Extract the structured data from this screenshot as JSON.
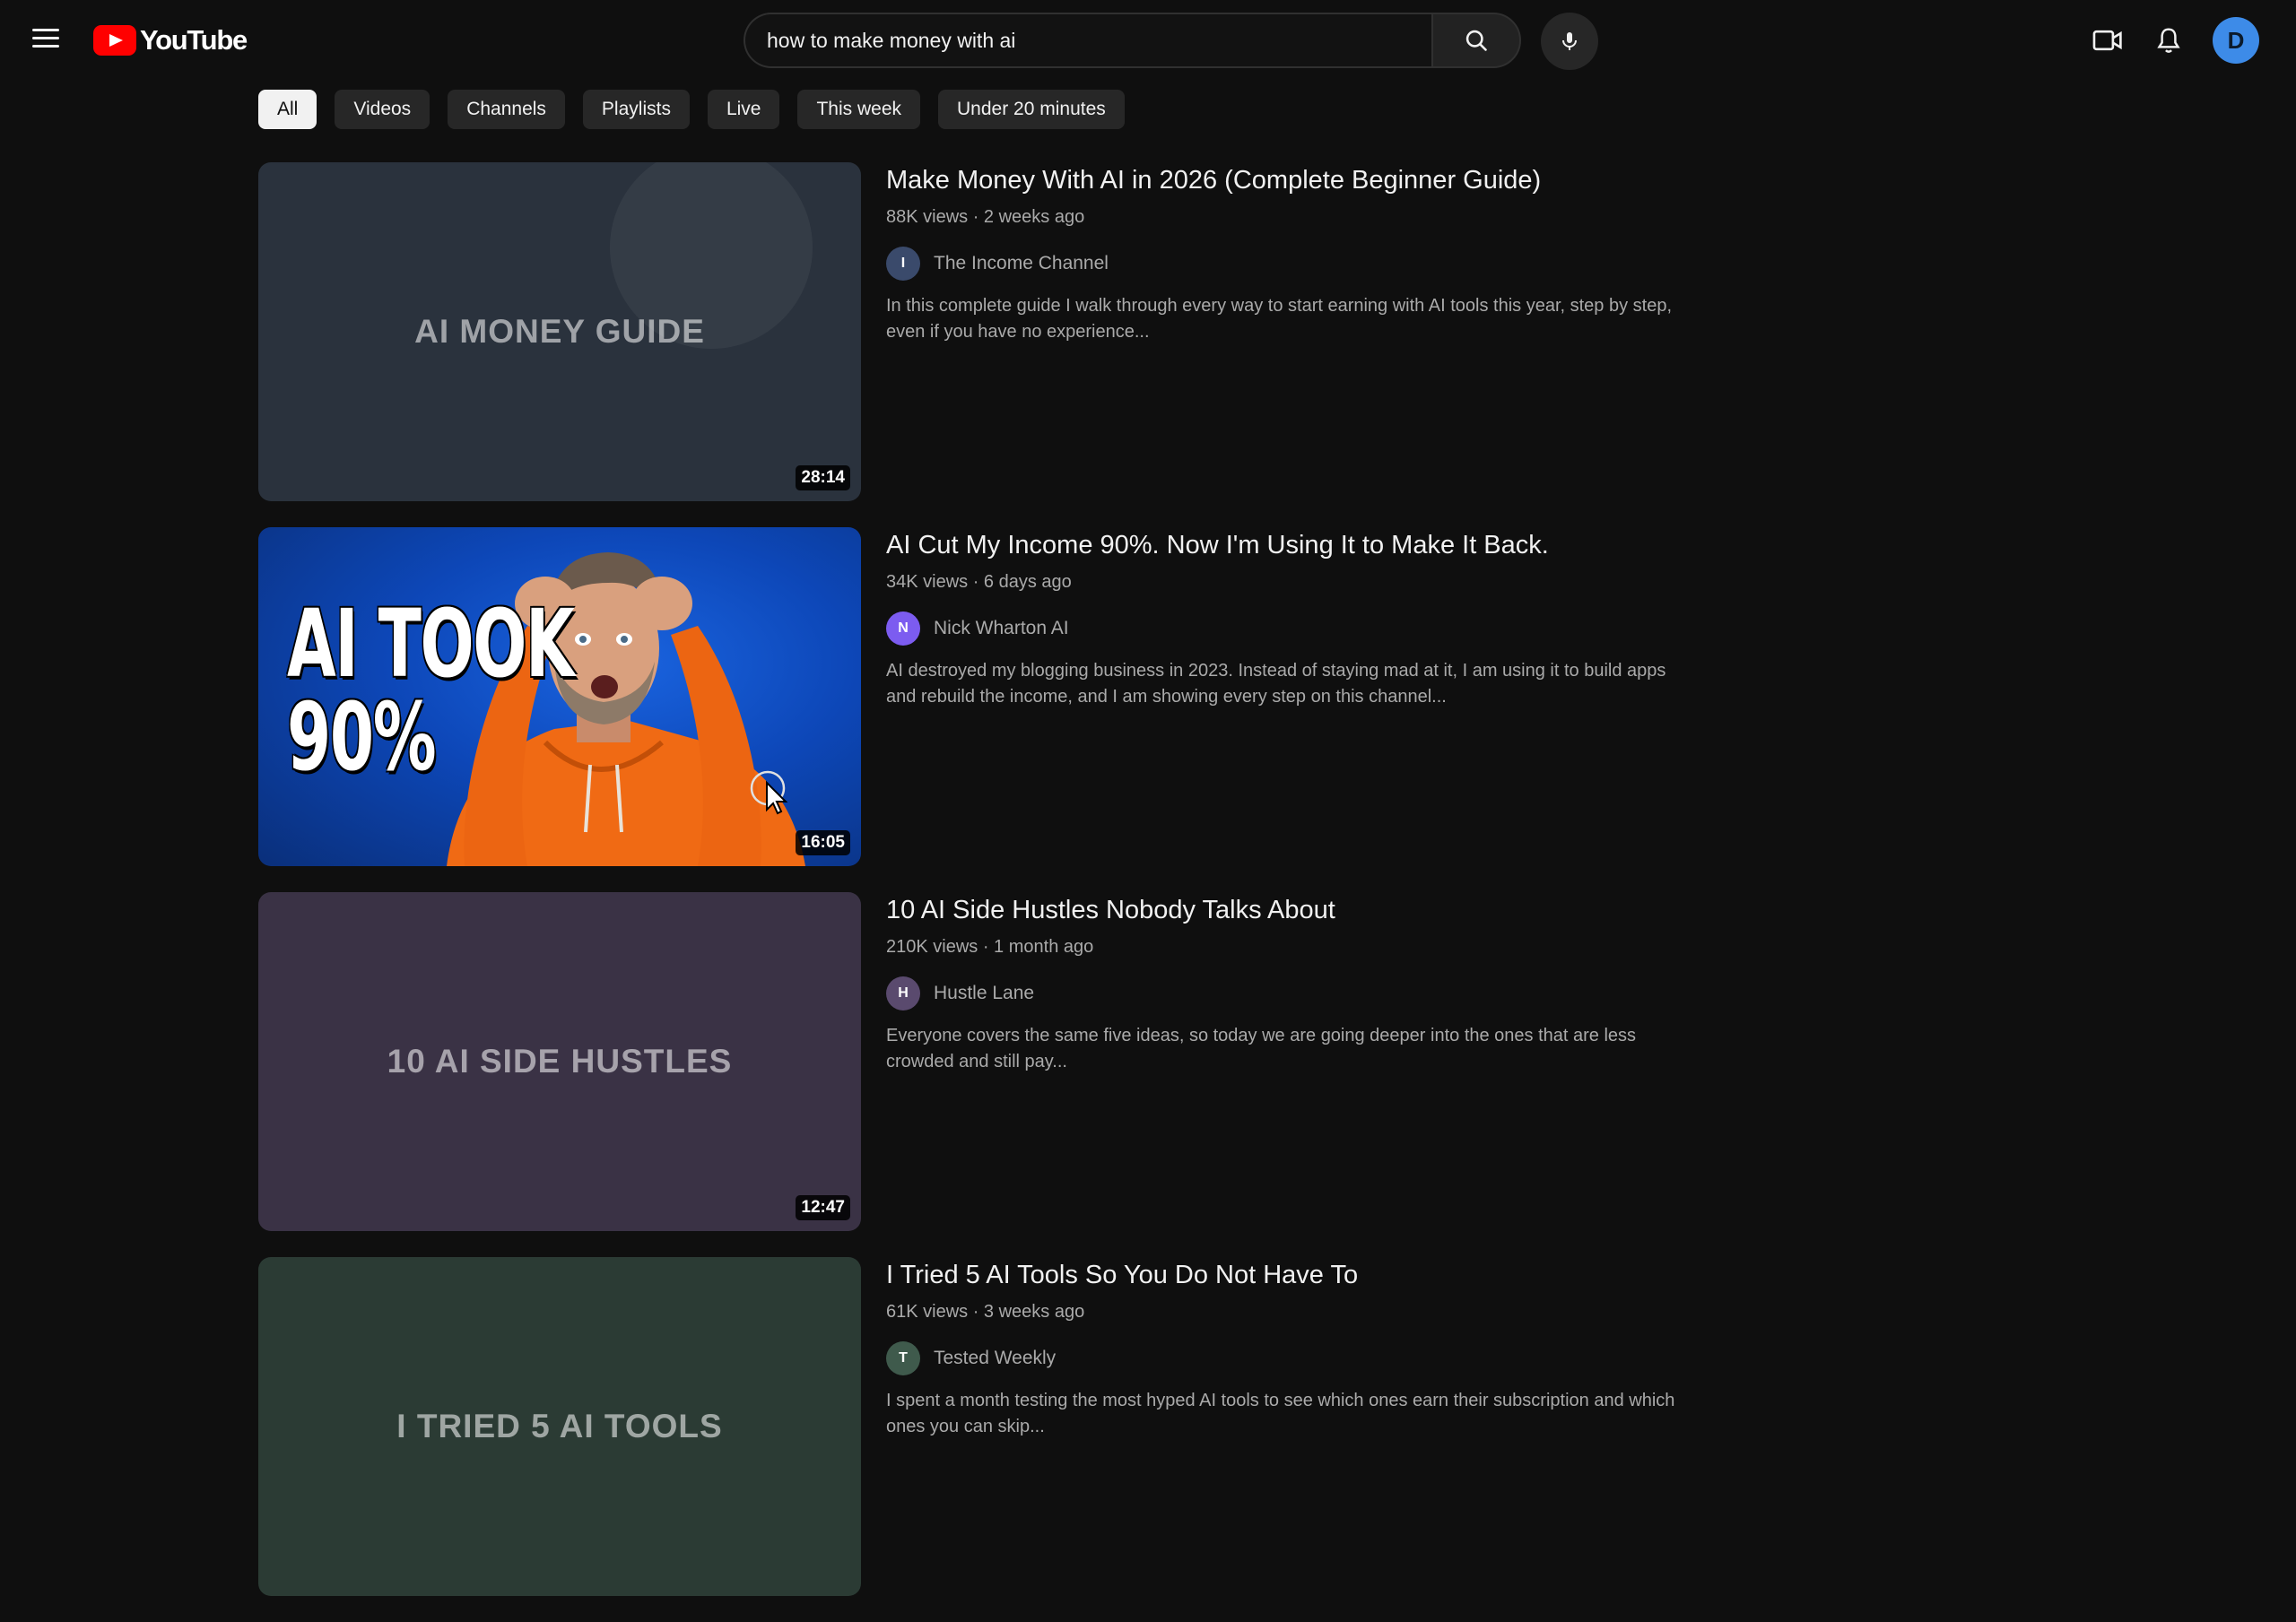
{
  "header": {
    "logo_text": "YouTube",
    "search_value": "how to make money with ai",
    "avatar_letter": "D"
  },
  "chips": [
    "All",
    "Videos",
    "Channels",
    "Playlists",
    "Live",
    "This week",
    "Under 20 minutes"
  ],
  "results": [
    {
      "title": "Make Money With AI in 2026 (Complete Beginner Guide)",
      "meta": "88K views · 2 weeks ago",
      "channel_initial": "I",
      "channel": "The Income Channel",
      "channel_color": "#3a4a6b",
      "description": "In this complete guide I walk through every way to start earning with AI tools this year, step by step, even if you have no experience...",
      "thumb_text": "AI MONEY GUIDE",
      "duration": "28:14"
    },
    {
      "title": "AI Cut My Income 90%. Now I'm Using It to Make It Back.",
      "meta": "34K views · 6 days ago",
      "channel_initial": "N",
      "channel": "Nick Wharton AI",
      "channel_color": "#7c5cf0",
      "description": "AI destroyed my blogging business in 2023. Instead of staying mad at it, I am using it to build apps and rebuild the income, and I am showing every step on this channel...",
      "thumb_text_line1": "AI TOOK",
      "thumb_text_line2": "90%",
      "duration": "16:05"
    },
    {
      "title": "10 AI Side Hustles Nobody Talks About",
      "meta": "210K views · 1 month ago",
      "channel_initial": "H",
      "channel": "Hustle Lane",
      "channel_color": "#5a4a6e",
      "description": "Everyone covers the same five ideas, so today we are going deeper into the ones that are less crowded and still pay...",
      "thumb_text": "10 AI SIDE HUSTLES",
      "duration": "12:47"
    },
    {
      "title": "I Tried 5 AI Tools So You Do Not Have To",
      "meta": "61K views · 3 weeks ago",
      "channel_initial": "T",
      "channel": "Tested Weekly",
      "channel_color": "#3f5a4c",
      "description": "I spent a month testing the most hyped AI tools to see which ones earn their subscription and which ones you can skip...",
      "thumb_text": "I TRIED 5 AI TOOLS",
      "duration": ""
    }
  ],
  "icons": {
    "menu": "hamburger-icon",
    "search": "search-icon",
    "mic": "microphone-icon",
    "create": "video-camera-icon",
    "notifications": "bell-icon"
  },
  "colors": {
    "background": "#0f0f0f",
    "brand_red": "#ff0000",
    "chip": "#272727",
    "chip_active": "#f1f1f1",
    "avatar": "#3d8be8"
  }
}
